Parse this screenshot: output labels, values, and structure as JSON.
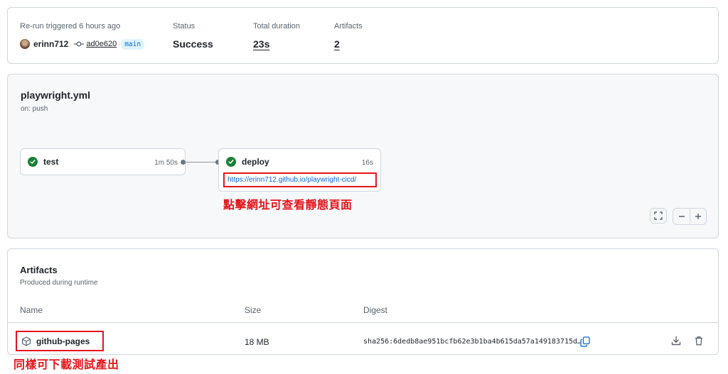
{
  "summary": {
    "trigger_label": "Re-run triggered 6 hours ago",
    "user": "erinn712",
    "commit": "ad0e620",
    "branch": "main",
    "status_label": "Status",
    "status_value": "Success",
    "duration_label": "Total duration",
    "duration_value": "23s",
    "artifacts_label": "Artifacts",
    "artifacts_value": "2"
  },
  "workflow": {
    "file": "playwright.yml",
    "trigger": "on: push",
    "jobs": [
      {
        "name": "test",
        "duration": "1m 50s",
        "status": "success"
      },
      {
        "name": "deploy",
        "duration": "16s",
        "status": "success",
        "url": "https://erinn712.github.io/playwright-cicd/"
      }
    ],
    "annotation": "點擊網址可查看靜態頁面"
  },
  "artifacts": {
    "title": "Artifacts",
    "subtitle": "Produced during runtime",
    "columns": {
      "name": "Name",
      "size": "Size",
      "digest": "Digest"
    },
    "rows": [
      {
        "name": "github-pages",
        "size": "18 MB",
        "digest": "sha256:6dedb8ae951bcfb62e3b1ba4b615da57a149183715d…"
      }
    ],
    "annotation": "同樣可下載測試產出"
  },
  "colors": {
    "success": "#1a7f37",
    "link": "#0969da",
    "annotation": "#e5151a",
    "border": "#d0d7de"
  }
}
